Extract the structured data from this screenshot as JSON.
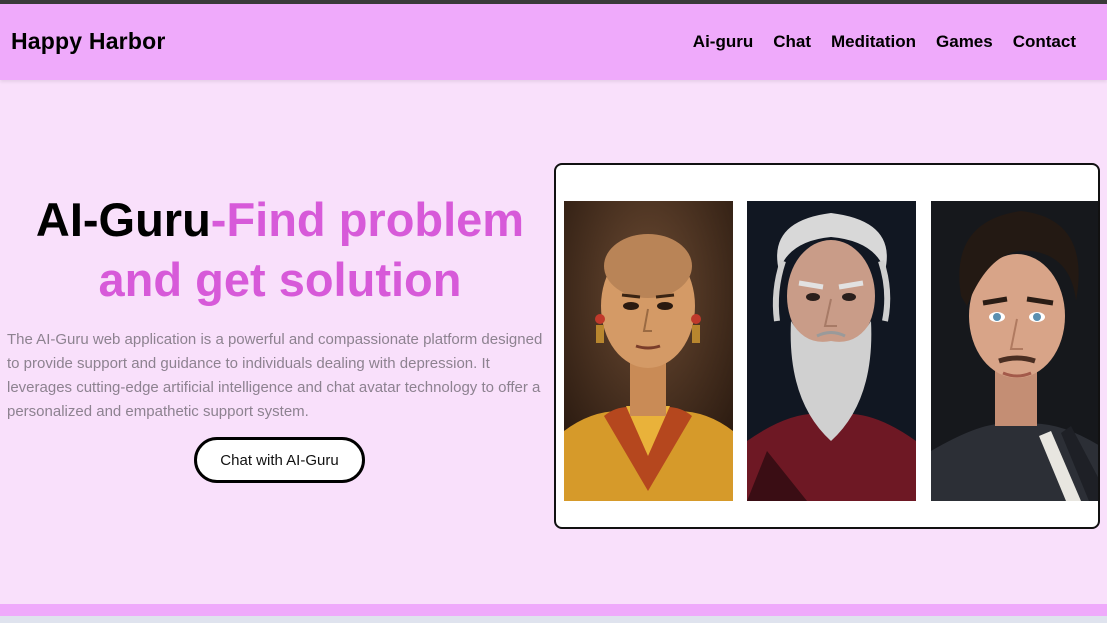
{
  "navbar": {
    "brand": "Happy Harbor",
    "links": [
      "Ai-guru",
      "Chat",
      "Meditation",
      "Games",
      "Contact"
    ]
  },
  "hero": {
    "title_main": "AI-Guru",
    "title_accent": "-Find problem and get solution",
    "description": "The AI-Guru web application is a powerful and compassionate platform designed to provide support and guidance to individuals dealing with depression. It leverages cutting-edge artificial intelligence and chat avatar technology to offer a personalized and empathetic support system.",
    "cta_label": "Chat with AI-Guru"
  },
  "gallery": {
    "portraits": [
      "monk-portrait",
      "old-sage-portrait",
      "young-man-portrait"
    ]
  },
  "colors": {
    "navbar_bg": "#efaafb",
    "page_bg": "#f9e0fb",
    "accent": "#d75ad9"
  }
}
